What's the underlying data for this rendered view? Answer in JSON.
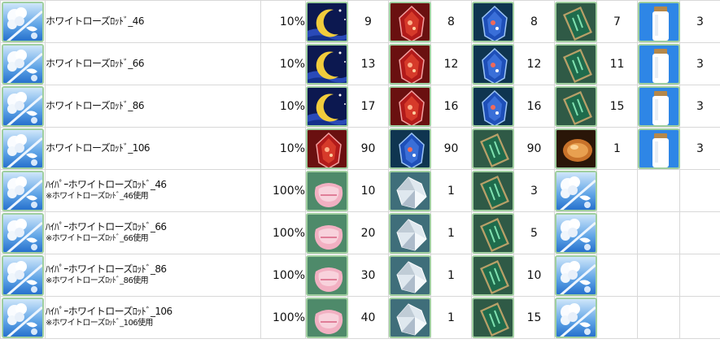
{
  "rows": [
    {
      "name": "ホワイトローズﾛｯﾄﾞ_46",
      "note": "",
      "rate": "10%",
      "materials": [
        {
          "icon": "crescent-moon-icon",
          "qty": "9"
        },
        {
          "icon": "red-crystal-icon",
          "qty": "8"
        },
        {
          "icon": "blue-crystal-icon",
          "qty": "8"
        },
        {
          "icon": "green-card-icon",
          "qty": "7"
        },
        {
          "icon": "white-bottle-icon",
          "qty": "3"
        }
      ]
    },
    {
      "name": "ホワイトローズﾛｯﾄﾞ_66",
      "note": "",
      "rate": "10%",
      "materials": [
        {
          "icon": "crescent-moon-icon",
          "qty": "13"
        },
        {
          "icon": "red-crystal-icon",
          "qty": "12"
        },
        {
          "icon": "blue-crystal-icon",
          "qty": "12"
        },
        {
          "icon": "green-card-icon",
          "qty": "11"
        },
        {
          "icon": "white-bottle-icon",
          "qty": "3"
        }
      ]
    },
    {
      "name": "ホワイトローズﾛｯﾄﾞ_86",
      "note": "",
      "rate": "10%",
      "materials": [
        {
          "icon": "crescent-moon-icon",
          "qty": "17"
        },
        {
          "icon": "red-crystal-icon",
          "qty": "16"
        },
        {
          "icon": "blue-crystal-icon",
          "qty": "16"
        },
        {
          "icon": "green-card-icon",
          "qty": "15"
        },
        {
          "icon": "white-bottle-icon",
          "qty": "3"
        }
      ]
    },
    {
      "name": "ホワイトローズﾛｯﾄﾞ_106",
      "note": "",
      "rate": "10%",
      "materials": [
        {
          "icon": "red-crystal-icon",
          "qty": "90"
        },
        {
          "icon": "blue-crystal-icon",
          "qty": "90"
        },
        {
          "icon": "green-card-icon",
          "qty": "90"
        },
        {
          "icon": "amber-coin-icon",
          "qty": "1"
        },
        {
          "icon": "white-bottle-icon",
          "qty": "3"
        }
      ]
    },
    {
      "name": "ﾊｲﾊﾟｰホワイトローズﾛｯﾄﾞ_46",
      "note": "※ホワイトローズﾛｯﾄﾞ_46使用",
      "rate": "100%",
      "materials": [
        {
          "icon": "pink-gem-icon",
          "qty": "10"
        },
        {
          "icon": "clear-crystal-icon",
          "qty": "1"
        },
        {
          "icon": "green-card-icon",
          "qty": "3"
        },
        {
          "icon": "white-rose-rod-icon",
          "qty": ""
        },
        {
          "icon": "",
          "qty": ""
        }
      ]
    },
    {
      "name": "ﾊｲﾊﾟｰホワイトローズﾛｯﾄﾞ_66",
      "note": "※ホワイトローズﾛｯﾄﾞ_66使用",
      "rate": "100%",
      "materials": [
        {
          "icon": "pink-gem-icon",
          "qty": "20"
        },
        {
          "icon": "clear-crystal-icon",
          "qty": "1"
        },
        {
          "icon": "green-card-icon",
          "qty": "5"
        },
        {
          "icon": "white-rose-rod-icon",
          "qty": ""
        },
        {
          "icon": "",
          "qty": ""
        }
      ]
    },
    {
      "name": "ﾊｲﾊﾟｰホワイトローズﾛｯﾄﾞ_86",
      "note": "※ホワイトローズﾛｯﾄﾞ_86使用",
      "rate": "100%",
      "materials": [
        {
          "icon": "pink-gem-icon",
          "qty": "30"
        },
        {
          "icon": "clear-crystal-icon",
          "qty": "1"
        },
        {
          "icon": "green-card-icon",
          "qty": "10"
        },
        {
          "icon": "white-rose-rod-icon",
          "qty": ""
        },
        {
          "icon": "",
          "qty": ""
        }
      ]
    },
    {
      "name": "ﾊｲﾊﾟｰホワイトローズﾛｯﾄﾞ_106",
      "note": "※ホワイトローズﾛｯﾄﾞ_106使用",
      "rate": "100%",
      "materials": [
        {
          "icon": "pink-gem-icon",
          "qty": "40"
        },
        {
          "icon": "clear-crystal-icon",
          "qty": "1"
        },
        {
          "icon": "green-card-icon",
          "qty": "15"
        },
        {
          "icon": "white-rose-rod-icon",
          "qty": ""
        },
        {
          "icon": "",
          "qty": ""
        }
      ]
    }
  ],
  "colors": {
    "grid_line": "#d8d8d8",
    "icon_border": "#9fce9f",
    "text": "#111111"
  }
}
